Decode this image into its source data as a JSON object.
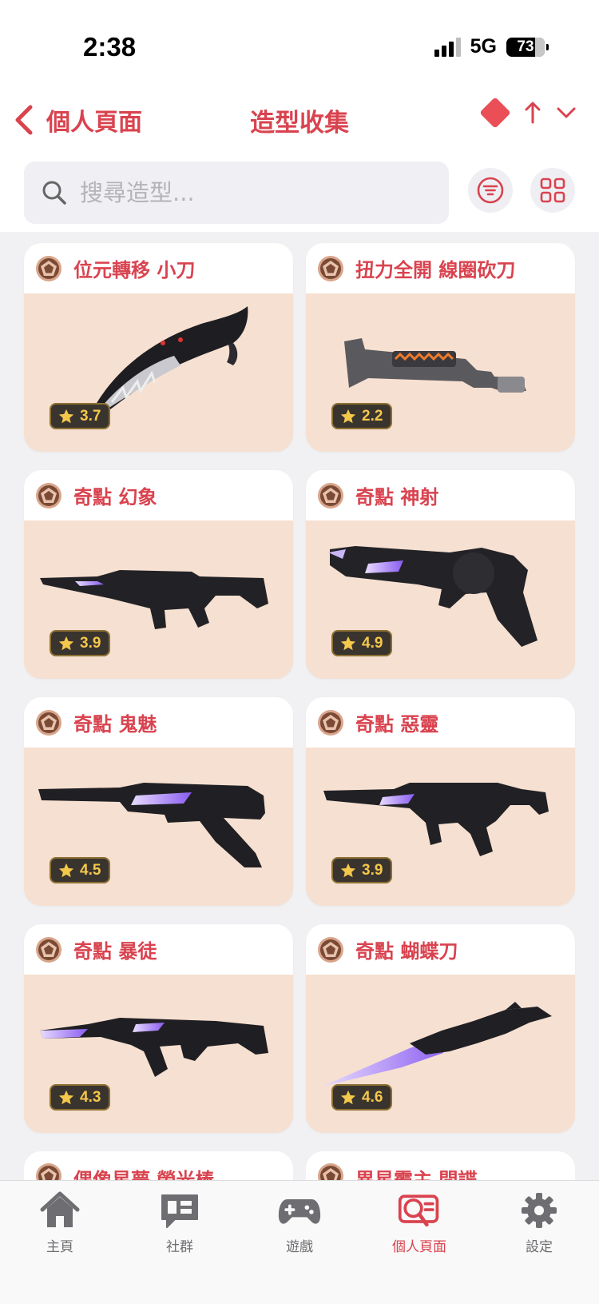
{
  "status": {
    "time": "2:38",
    "network": "5G",
    "battery": "73"
  },
  "header": {
    "back_label": "個人頁面",
    "title": "造型收集"
  },
  "search": {
    "placeholder": "搜尋造型..."
  },
  "cards": [
    {
      "name": "位元轉移 小刀",
      "rating": "3.7",
      "weapon": "knife-karambit"
    },
    {
      "name": "扭力全開 線圈砍刀",
      "rating": "2.2",
      "weapon": "machete"
    },
    {
      "name": "奇點 幻象",
      "rating": "3.9",
      "weapon": "rifle-phantom"
    },
    {
      "name": "奇點 神射",
      "rating": "4.9",
      "weapon": "revolver-sheriff"
    },
    {
      "name": "奇點 鬼魅",
      "rating": "4.5",
      "weapon": "pistol-ghost"
    },
    {
      "name": "奇點 惡靈",
      "rating": "3.9",
      "weapon": "smg-spectre"
    },
    {
      "name": "奇點 暴徒",
      "rating": "4.3",
      "weapon": "rifle-vandal"
    },
    {
      "name": "奇點 蝴蝶刀",
      "rating": "4.6",
      "weapon": "butterfly-knife"
    }
  ],
  "partial_cards": [
    {
      "name": "偶像星夢 螢光棒"
    },
    {
      "name": "異星霸主 間諜"
    }
  ],
  "tabs": [
    {
      "label": "主頁",
      "icon": "home-icon",
      "active": false
    },
    {
      "label": "社群",
      "icon": "chat-icon",
      "active": false
    },
    {
      "label": "遊戲",
      "icon": "gamepad-icon",
      "active": false
    },
    {
      "label": "個人頁面",
      "icon": "profile-search-icon",
      "active": true
    },
    {
      "label": "設定",
      "icon": "gear-icon",
      "active": false
    }
  ],
  "colors": {
    "accent": "#d9434f",
    "card_bg": "#f6e0d1",
    "rating_text": "#f4c84a",
    "sort_diamond": "#ea4f58"
  }
}
